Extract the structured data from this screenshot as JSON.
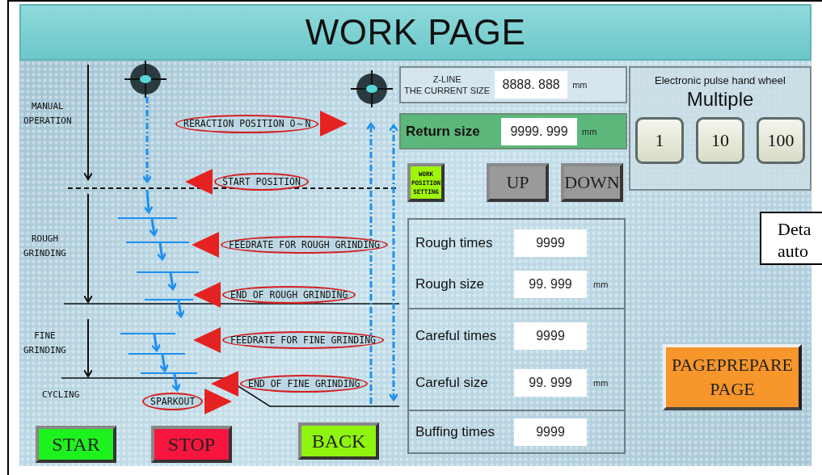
{
  "title": "WORK PAGE",
  "stages": [
    {
      "lines": [
        "MANUAL",
        "OPERATION"
      ]
    },
    {
      "lines": [
        "ROUGH",
        "GRINDING"
      ]
    },
    {
      "lines": [
        "FINE",
        "GRINDING"
      ]
    },
    {
      "lines": [
        "CYCLING"
      ]
    }
  ],
  "callouts": [
    {
      "text": "RERACTION POSITION O～N",
      "kind": "right"
    },
    {
      "text": "START POSITION",
      "kind": "left"
    },
    {
      "text": "FEEDRATE FOR ROUGH GRINDING",
      "kind": "left"
    },
    {
      "text": "END OF ROUGH GRINDING",
      "kind": "left"
    },
    {
      "text": "FEEDRATE FOR FINE GRINDING",
      "kind": "left"
    },
    {
      "text": "END OF FINE GRINDING",
      "kind": "left"
    },
    {
      "text": "SPARKOUT",
      "kind": "right"
    }
  ],
  "control_buttons": [
    {
      "label": "STAR",
      "kind": "start"
    },
    {
      "label": "STOP",
      "kind": "stop"
    },
    {
      "label": "BACK",
      "kind": "back"
    }
  ],
  "z_line": {
    "label_lines": [
      "Z-LINE",
      "THE CURRENT SIZE"
    ],
    "value": "8888. 888",
    "unit": "mm"
  },
  "return_size": {
    "label": "Return size",
    "value": "9999. 999",
    "unit": "mm"
  },
  "work_position_button": [
    "WORK",
    "POSITION",
    "SETTING"
  ],
  "jog_buttons": [
    "UP",
    "DOWN"
  ],
  "hand_wheel": {
    "caption": "Electronic pulse hand wheel",
    "title": "Multiple",
    "multipliers": [
      "1",
      "10",
      "100"
    ]
  },
  "parameter_groups": [
    [
      {
        "label": "Rough times",
        "value": "9999"
      },
      {
        "label": "Rough size",
        "value": "99. 999",
        "unit": "mm"
      }
    ],
    [
      {
        "label": "Careful times",
        "value": "9999"
      },
      {
        "label": "Careful size",
        "value": "99. 999",
        "unit": "mm"
      }
    ],
    [
      {
        "label": "Buffing times",
        "value": "9999"
      }
    ]
  ],
  "page_button": [
    "PAGEPREPARE",
    "PAGE"
  ],
  "note": [
    "Deta",
    "auto"
  ]
}
